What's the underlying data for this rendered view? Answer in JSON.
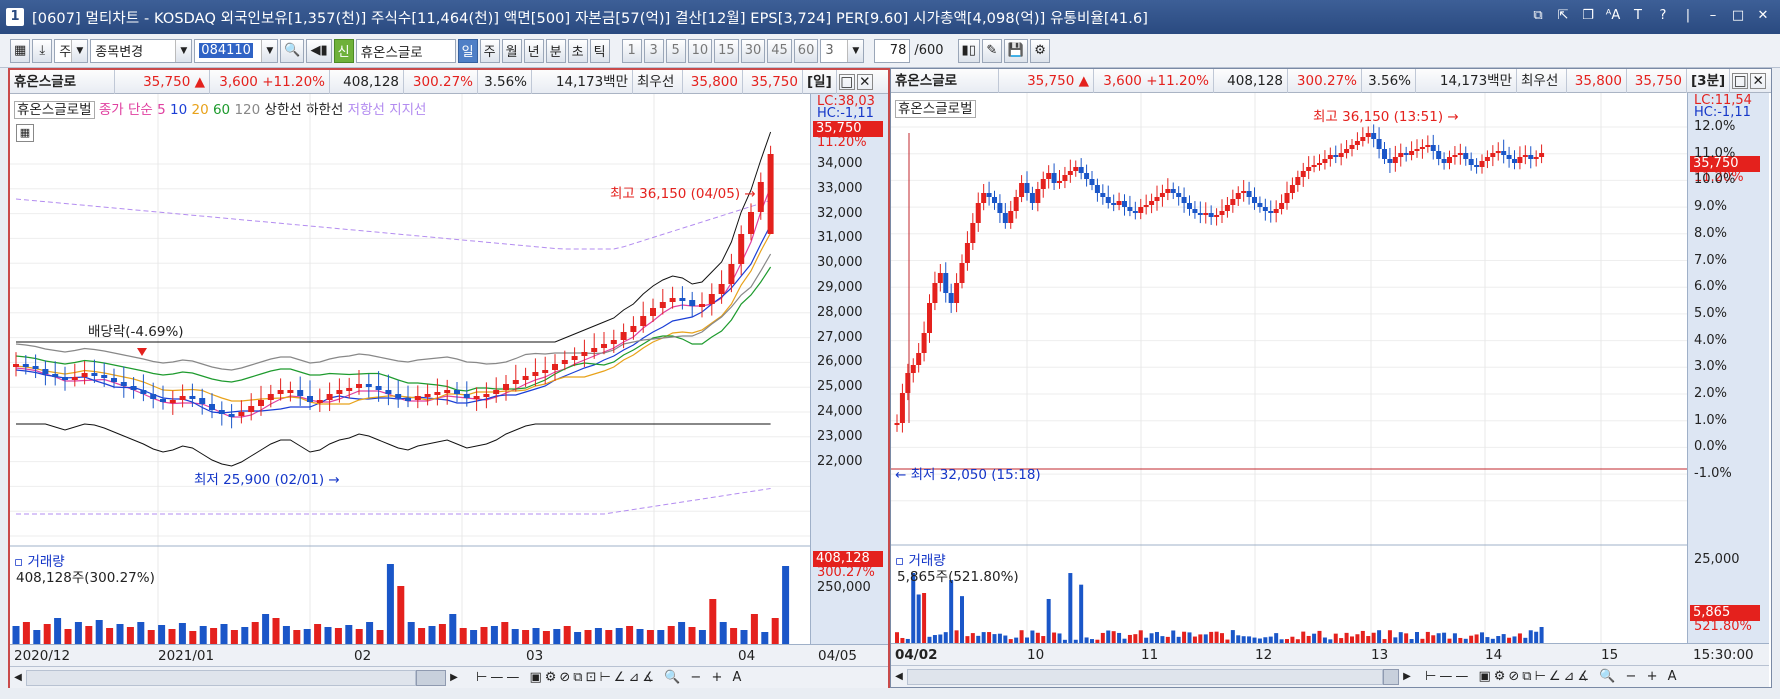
{
  "window": {
    "title": "[0607] 멀티차트 - KOSDAQ 외국인보유[1,357(천)] 주식수[11,464(천)] 액면[500] 자본금[57(억)] 결산[12월] EPS[3,724] PER[9.60] 시가총액[4,098(억)] 유통비율[41.6]",
    "number": "1"
  },
  "toolbar": {
    "market_label": "주",
    "stock_change": "종목변경",
    "code": "084110",
    "stock_name": "휴온스글로",
    "new_badge": "신",
    "periods": [
      "일",
      "주",
      "월",
      "년",
      "분",
      "초",
      "틱"
    ],
    "selected_period": "일",
    "numbers": [
      "1",
      "3",
      "5",
      "10",
      "15",
      "30",
      "45",
      "60"
    ],
    "interval": "3",
    "count": "78",
    "count_total": "/600"
  },
  "left": {
    "info": {
      "name": "휴온스글로",
      "price": "35,750",
      "arrow": "▲",
      "change": "3,600",
      "pct": "+11.20%",
      "volume": "408,128",
      "vol_pct": "300.27%",
      "turnover": "3.56%",
      "amount": "14,173백만",
      "bid_label": "최우선",
      "ask": "35,800",
      "bid": "35,750",
      "period_tag": "[일]"
    },
    "legend": {
      "name": "휴온스글로벌",
      "ma_label": "종가 단순",
      "ma5": "5",
      "ma10": "10",
      "ma20": "20",
      "ma60": "60",
      "ma120": "120",
      "upper": "상한선",
      "lower": "하한선",
      "resist": "저항선",
      "support": "지지선"
    },
    "corner": {
      "lc": "LC:38,03",
      "hc": "HC:-1,11",
      "price": "35,750",
      "pct": "11.20%"
    },
    "y_ticks": [
      "34,000",
      "33,000",
      "32,000",
      "31,000",
      "30,000",
      "29,000",
      "28,000",
      "27,000",
      "26,000",
      "25,000",
      "24,000",
      "23,000",
      "22,000"
    ],
    "annotations": {
      "high": "최고 36,150 (04/05)",
      "low": "최저 25,900 (02/01)",
      "dividend": "배당락(-4.69%)"
    },
    "volume": {
      "title": "거래량",
      "value": "408,128주(300.27%)",
      "box_value": "408,128",
      "box_pct": "300.27%",
      "tick": "250,000"
    },
    "x_labels": [
      "2020/12",
      "2021/01",
      "02",
      "03",
      "04",
      "04/05"
    ]
  },
  "right": {
    "info": {
      "name": "휴온스글로",
      "price": "35,750",
      "arrow": "▲",
      "change": "3,600",
      "pct": "+11.20%",
      "volume": "408,128",
      "vol_pct": "300.27%",
      "turnover": "3.56%",
      "amount": "14,173백만",
      "bid_label": "최우선",
      "ask": "35,800",
      "bid": "35,750",
      "period_tag": "[3분]"
    },
    "legend": {
      "name": "휴온스글로벌"
    },
    "corner": {
      "lc": "LC:11,54",
      "hc": "HC:-1,11",
      "price": "35,750",
      "pct": "11.20%"
    },
    "y_ticks": [
      "12.0%",
      "11.0%",
      "10.0%",
      "9.0%",
      "8.0%",
      "7.0%",
      "6.0%",
      "5.0%",
      "4.0%",
      "3.0%",
      "2.0%",
      "1.0%",
      "0.0%",
      "-1.0%"
    ],
    "annotations": {
      "high": "최고 36,150 (13:51)",
      "low": "최저 32,050 (15:18)"
    },
    "volume": {
      "title": "거래량",
      "value": "5,865주(521.80%)",
      "box_value": "5,865",
      "box_pct": "521.80%",
      "tick": "25,000"
    },
    "x_labels": [
      "04/02",
      "10",
      "11",
      "12",
      "13",
      "14",
      "15",
      "15:30:00"
    ]
  },
  "colors": {
    "up": "#e4211d",
    "down": "#1a56c8",
    "ma5": "#e040a0",
    "ma10": "#1b3fd6",
    "ma20": "#e8a21a",
    "ma60": "#1e9b2e",
    "ma120": "#888888",
    "bollinger": "#111111",
    "envelope": "#b38cf0"
  }
}
